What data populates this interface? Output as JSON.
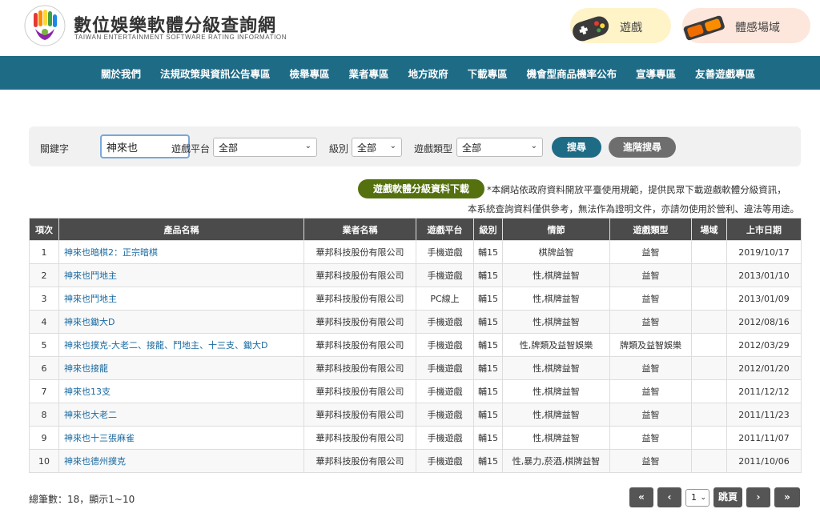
{
  "header": {
    "title": "數位娛樂軟體分級查詢網",
    "subtitle": "TAIWAN ENTERTAINMENT SOFTWARE RATING INFORMATION",
    "games_label": "遊戲",
    "vr_label": "體感場域"
  },
  "nav": {
    "items": [
      "關於我們",
      "法規政策與資訊公告專區",
      "檢舉專區",
      "業者專區",
      "地方政府",
      "下載專區",
      "機會型商品機率公布",
      "宣導專區",
      "友善遊戲專區"
    ]
  },
  "search": {
    "keyword_label": "關鍵字",
    "keyword_value": "神來也",
    "platform_label": "遊戲平台",
    "platform_value": "全部",
    "rating_label": "級別",
    "rating_value": "全部",
    "genre_label": "遊戲類型",
    "genre_value": "全部",
    "search_button": "搜尋",
    "advanced_button": "進階搜尋"
  },
  "download": {
    "button": "遊戲軟體分級資料下載",
    "notice_1": "*本網站依政府資料開放平臺使用規範，提供民眾下載遊戲軟體分級資訊，",
    "notice_2": "本系統查詢資料僅供參考，無法作為證明文件，亦請勿使用於營利、違法等用途。"
  },
  "table": {
    "headers": [
      "項次",
      "產品名稱",
      "業者名稱",
      "遊戲平台",
      "級別",
      "情節",
      "遊戲類型",
      "場域",
      "上市日期"
    ],
    "rows": [
      [
        "1",
        "神來也暗棋2：正宗暗棋",
        "華邦科技股份有限公司",
        "手機遊戲",
        "輔15",
        "棋牌益智",
        "益智",
        "",
        "2019/10/17"
      ],
      [
        "2",
        "神來也鬥地主",
        "華邦科技股份有限公司",
        "手機遊戲",
        "輔15",
        "性,棋牌益智",
        "益智",
        "",
        "2013/01/10"
      ],
      [
        "3",
        "神來也鬥地主",
        "華邦科技股份有限公司",
        "PC線上",
        "輔15",
        "性,棋牌益智",
        "益智",
        "",
        "2013/01/09"
      ],
      [
        "4",
        "神來也鋤大D",
        "華邦科技股份有限公司",
        "手機遊戲",
        "輔15",
        "性,棋牌益智",
        "益智",
        "",
        "2012/08/16"
      ],
      [
        "5",
        "神來也撲克-大老二、接龍、鬥地主、十三支、鋤大D",
        "華邦科技股份有限公司",
        "手機遊戲",
        "輔15",
        "性,牌類及益智娛樂",
        "牌類及益智娛樂",
        "",
        "2012/03/29"
      ],
      [
        "6",
        "神來也接龍",
        "華邦科技股份有限公司",
        "手機遊戲",
        "輔15",
        "性,棋牌益智",
        "益智",
        "",
        "2012/01/20"
      ],
      [
        "7",
        "神來也13支",
        "華邦科技股份有限公司",
        "手機遊戲",
        "輔15",
        "性,棋牌益智",
        "益智",
        "",
        "2011/12/12"
      ],
      [
        "8",
        "神來也大老二",
        "華邦科技股份有限公司",
        "手機遊戲",
        "輔15",
        "性,棋牌益智",
        "益智",
        "",
        "2011/11/23"
      ],
      [
        "9",
        "神來也十三張麻雀",
        "華邦科技股份有限公司",
        "手機遊戲",
        "輔15",
        "性,棋牌益智",
        "益智",
        "",
        "2011/11/07"
      ],
      [
        "10",
        "神來也德州撲克",
        "華邦科技股份有限公司",
        "手機遊戲",
        "輔15",
        "性,暴力,菸酒,棋牌益智",
        "益智",
        "",
        "2011/10/06"
      ]
    ]
  },
  "footer": {
    "total_text": "總筆數：18，顯示1~10",
    "page_value": "1",
    "first": "«",
    "prev": "‹",
    "jump": "跳頁",
    "next": "›",
    "last": "»"
  },
  "colors": {
    "nav": "#1e6b86",
    "download": "#55710f",
    "table_header": "#4b4b4b",
    "link": "#1a6aa0"
  }
}
